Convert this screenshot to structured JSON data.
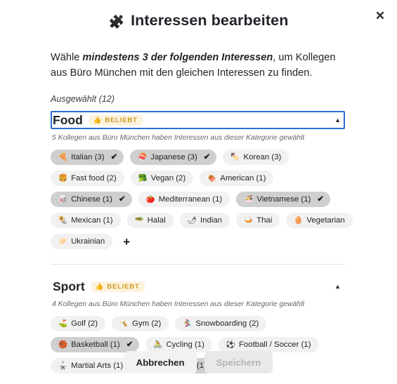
{
  "modal": {
    "title": "Interessen bearbeiten",
    "title_icon": "puzzle-piece-icon",
    "title_icon_glyph": "🧩",
    "close_label": "✕",
    "intro_prefix": "Wähle ",
    "intro_bold": "mindestens 3 der folgenden Interessen",
    "intro_suffix": ", um Kollegen aus Büro München mit den gleichen Interessen zu finden.",
    "selected_count_label": "Ausgewählt (12)"
  },
  "colors": {
    "focus_border": "#2b6fd4",
    "badge_bg": "#fdf3dd",
    "badge_text": "#cf9b28",
    "chip_bg": "#f1f1f1",
    "chip_selected_bg": "#cfcfcf",
    "text": "#212529"
  },
  "categories": [
    {
      "name": "Food",
      "badge": "BELIEBT",
      "badge_icon": "thumbs-up-icon",
      "badge_glyph": "👍",
      "focused": true,
      "expanded": true,
      "caret": "▲",
      "subtitle": "5 Kollegen aus Büro München haben Interessen aus dieser Kategorie gewählt",
      "add_label": "+",
      "chips": [
        {
          "label": "Italian (3)",
          "emoji": "🍕",
          "icon": "pizza-icon",
          "selected": true
        },
        {
          "label": "Japanese (3)",
          "emoji": "🍣",
          "icon": "sushi-icon",
          "selected": true
        },
        {
          "label": "Korean (3)",
          "emoji": "🍢",
          "icon": "oden-icon",
          "selected": false
        },
        {
          "label": "Fast food (2)",
          "emoji": "🍔",
          "icon": "burger-icon",
          "selected": false
        },
        {
          "label": "Vegan (2)",
          "emoji": "🥦",
          "icon": "broccoli-icon",
          "selected": false
        },
        {
          "label": "American (1)",
          "emoji": "🍖",
          "icon": "meat-icon",
          "selected": false
        },
        {
          "label": "Chinese (1)",
          "emoji": "🥡",
          "icon": "takeout-box-icon",
          "selected": true
        },
        {
          "label": "Mediterranean (1)",
          "emoji": "🍅",
          "icon": "tomato-icon",
          "selected": false
        },
        {
          "label": "Vietnamese (1)",
          "emoji": "🍜",
          "icon": "noodle-bowl-icon",
          "selected": true
        },
        {
          "label": "Mexican (1)",
          "emoji": "🌯",
          "icon": "burrito-icon",
          "selected": false
        },
        {
          "label": "Halal",
          "emoji": "🥗",
          "icon": "salad-icon",
          "selected": false
        },
        {
          "label": "Indian",
          "emoji": "🌶",
          "icon": "chili-pepper-icon",
          "selected": false
        },
        {
          "label": "Thai",
          "emoji": "🍛",
          "icon": "curry-rice-icon",
          "selected": false
        },
        {
          "label": "Vegetarian",
          "emoji": "🥚",
          "icon": "egg-icon",
          "selected": false
        },
        {
          "label": "Ukrainian",
          "emoji": "🥟",
          "icon": "dumpling-icon",
          "selected": false
        }
      ]
    },
    {
      "name": "Sport",
      "badge": "BELIEBT",
      "badge_icon": "thumbs-up-icon",
      "badge_glyph": "👍",
      "focused": false,
      "expanded": true,
      "caret": "▲",
      "subtitle": "4 Kollegen aus Büro München haben Interessen aus dieser Kategorie gewählt",
      "add_label": "+",
      "chips": [
        {
          "label": "Golf (2)",
          "emoji": "⛳",
          "icon": "golf-flag-icon",
          "selected": false
        },
        {
          "label": "Gym (2)",
          "emoji": "🤸",
          "icon": "gymnast-icon",
          "selected": false
        },
        {
          "label": "Snowboarding (2)",
          "emoji": "🏂",
          "icon": "snowboarder-icon",
          "selected": false
        },
        {
          "label": "Basketball (1)",
          "emoji": "🏀",
          "icon": "basketball-icon",
          "selected": true
        },
        {
          "label": "Cycling (1)",
          "emoji": "🚴",
          "icon": "cyclist-icon",
          "selected": false
        },
        {
          "label": "Football / Soccer (1)",
          "emoji": "⚽",
          "icon": "soccer-ball-icon",
          "selected": false
        },
        {
          "label": "Martial Arts (1)",
          "emoji": "🥋",
          "icon": "martial-arts-icon",
          "selected": false
        },
        {
          "label": "Swimming (1)",
          "emoji": "🏊",
          "icon": "swimmer-icon",
          "selected": true
        }
      ]
    }
  ],
  "footer": {
    "cancel_label": "Abbrechen",
    "save_label": "Speichern",
    "save_disabled": true
  },
  "checkmark": "✔"
}
